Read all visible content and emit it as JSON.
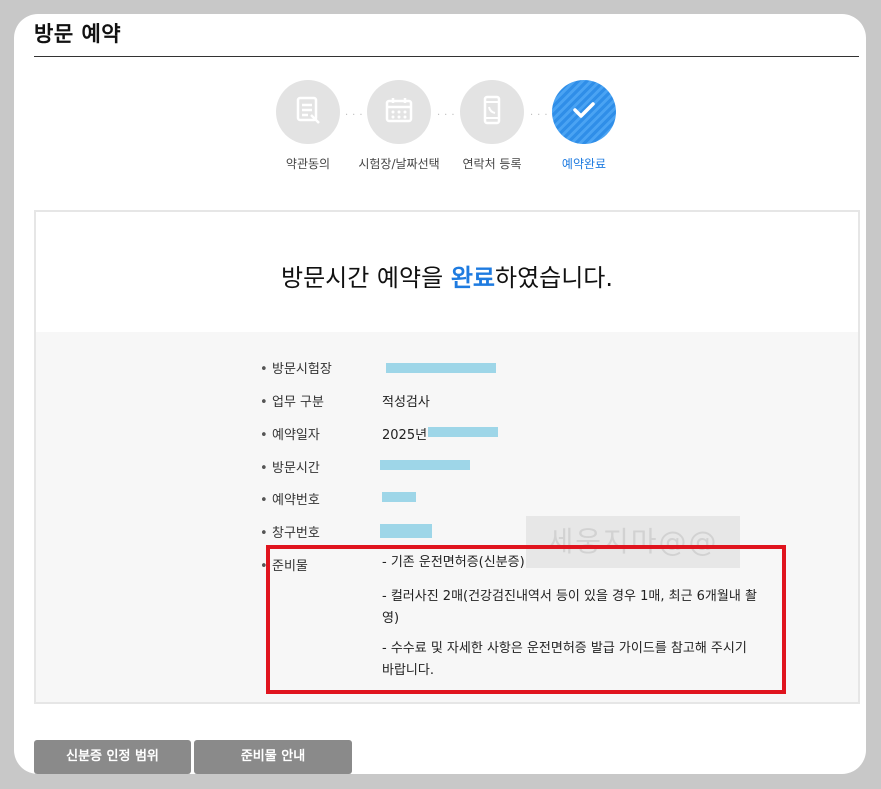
{
  "page_title": "방문 예약",
  "steps": [
    {
      "label": "약관동의",
      "icon": "document-icon",
      "active": false
    },
    {
      "label": "시험장/날짜선택",
      "icon": "calendar-icon",
      "active": false
    },
    {
      "label": "연락처 등록",
      "icon": "phone-icon",
      "active": false
    },
    {
      "label": "예약완료",
      "icon": "check-icon",
      "active": true
    }
  ],
  "headline": {
    "before": "방문시간 예약을 ",
    "highlight": "완료",
    "after": "하였습니다."
  },
  "info": {
    "visit_site_label": "방문시험장",
    "business_label": "업무 구분",
    "business_value": "적성검사",
    "date_label": "예약일자",
    "date_value": "2025년",
    "time_label": "방문시간",
    "reservation_no_label": "예약번호",
    "window_no_label": "창구번호",
    "prep_label": "준비물",
    "prep_items": [
      "- 기존 운전면허증(신분증)",
      "- 컬러사진 2매(건강검진내역서 등이 있을 경우 1매, 최근 6개월내 촬영)",
      "- 수수료 및 자세한 사항은 운전면허증 발급 가이드를 참고해 주시기 바랍니다."
    ]
  },
  "watermark": "세웅지마@@",
  "buttons": {
    "id_scope": "신분증 인정 범위",
    "prep_guide": "준비물 안내"
  },
  "colors": {
    "accent": "#1e7be0",
    "highlight_frame": "#e0141e",
    "redaction": "#9ed6e8",
    "button_bg": "#8a8a8a"
  }
}
